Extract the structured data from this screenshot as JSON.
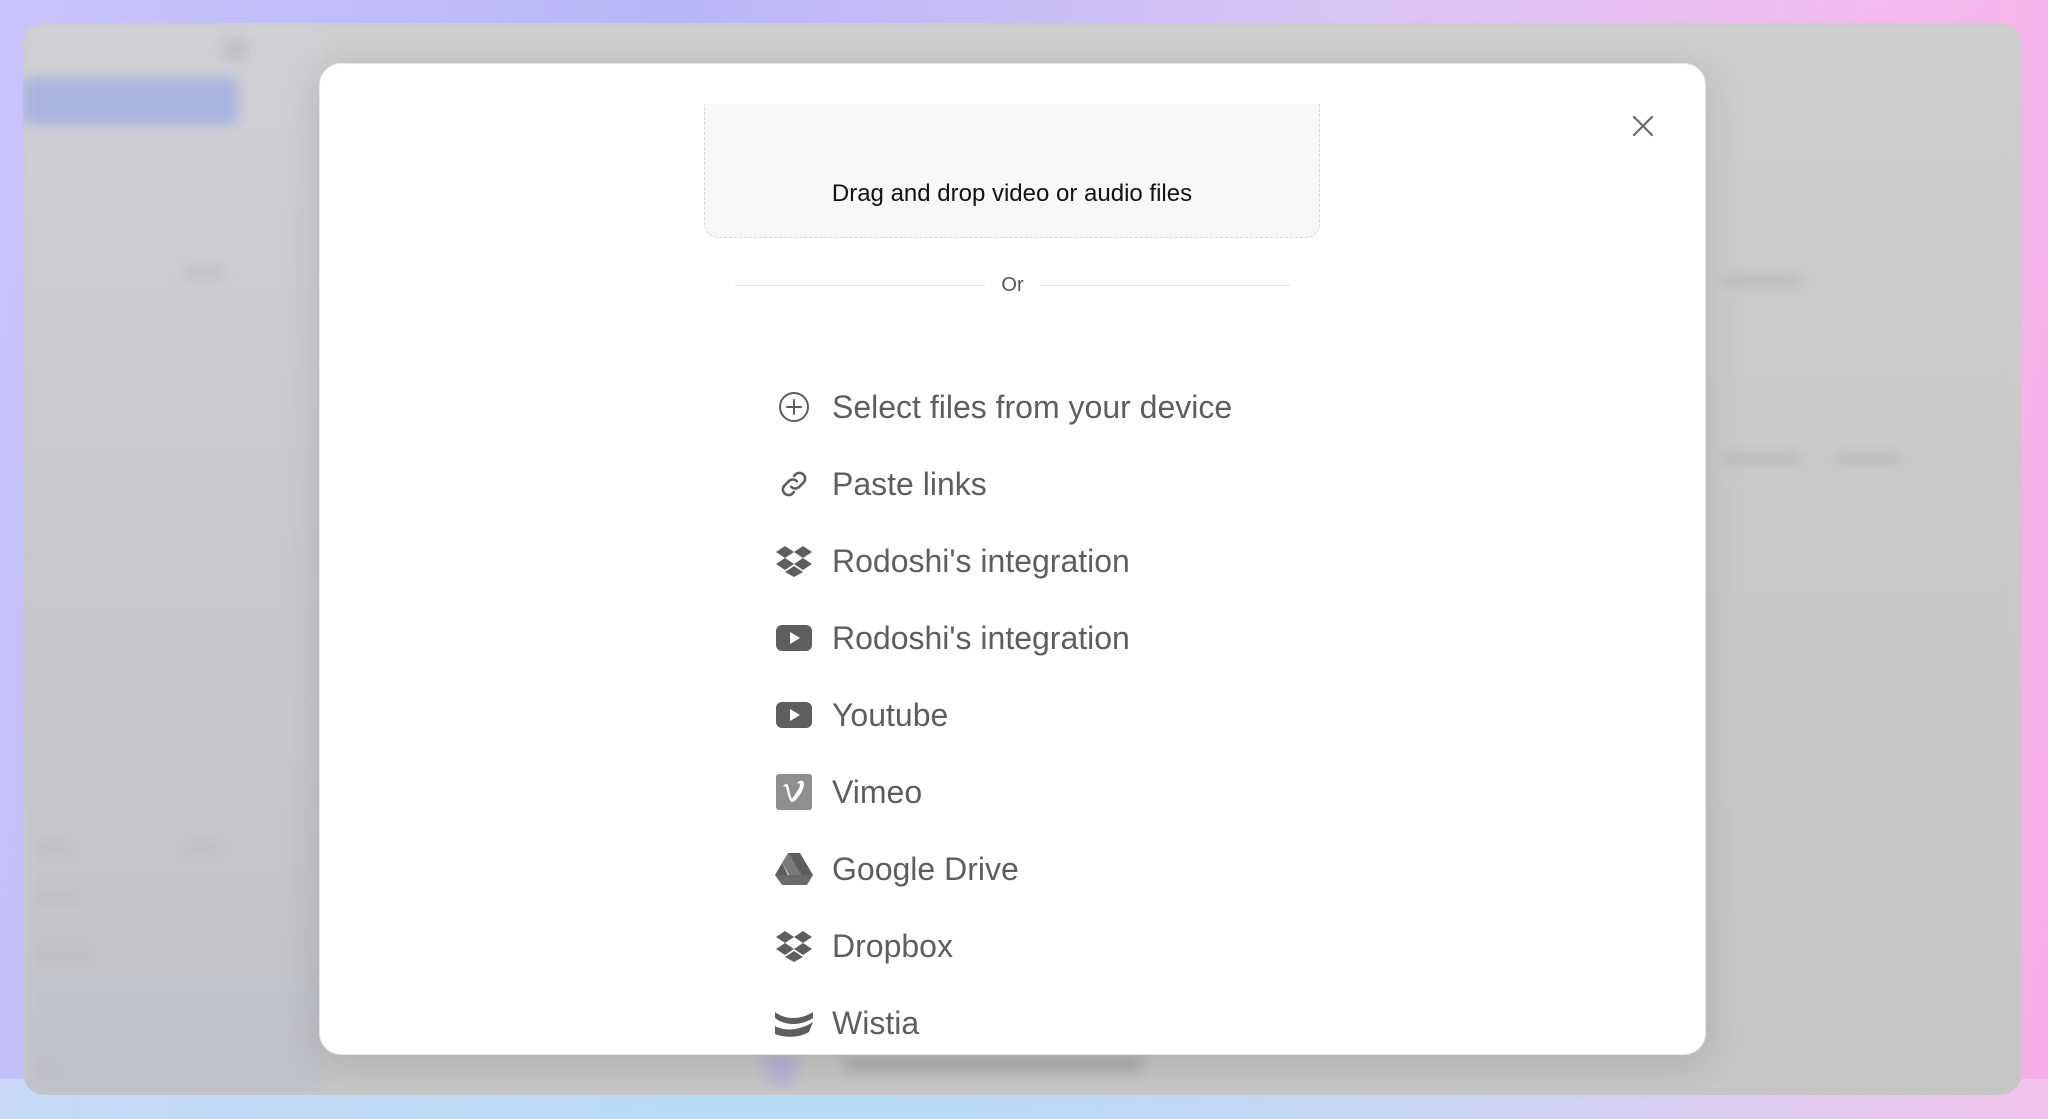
{
  "modal": {
    "dropzone_text": "Drag and drop video or audio files",
    "divider_text": "Or",
    "options": [
      {
        "label": "Select files from your device",
        "icon": "plus-circle-icon"
      },
      {
        "label": "Paste links",
        "icon": "link-icon"
      },
      {
        "label": "Rodoshi's integration",
        "icon": "dropbox-icon"
      },
      {
        "label": "Rodoshi's integration",
        "icon": "youtube-icon"
      },
      {
        "label": "Youtube",
        "icon": "youtube-icon"
      },
      {
        "label": "Vimeo",
        "icon": "vimeo-icon"
      },
      {
        "label": "Google Drive",
        "icon": "google-drive-icon"
      },
      {
        "label": "Dropbox",
        "icon": "dropbox-icon"
      },
      {
        "label": "Wistia",
        "icon": "wistia-icon"
      }
    ]
  },
  "colors": {
    "icon_gray": "#5e5e5e",
    "label_gray": "#5e5e5e",
    "modal_bg": "#ffffff"
  }
}
